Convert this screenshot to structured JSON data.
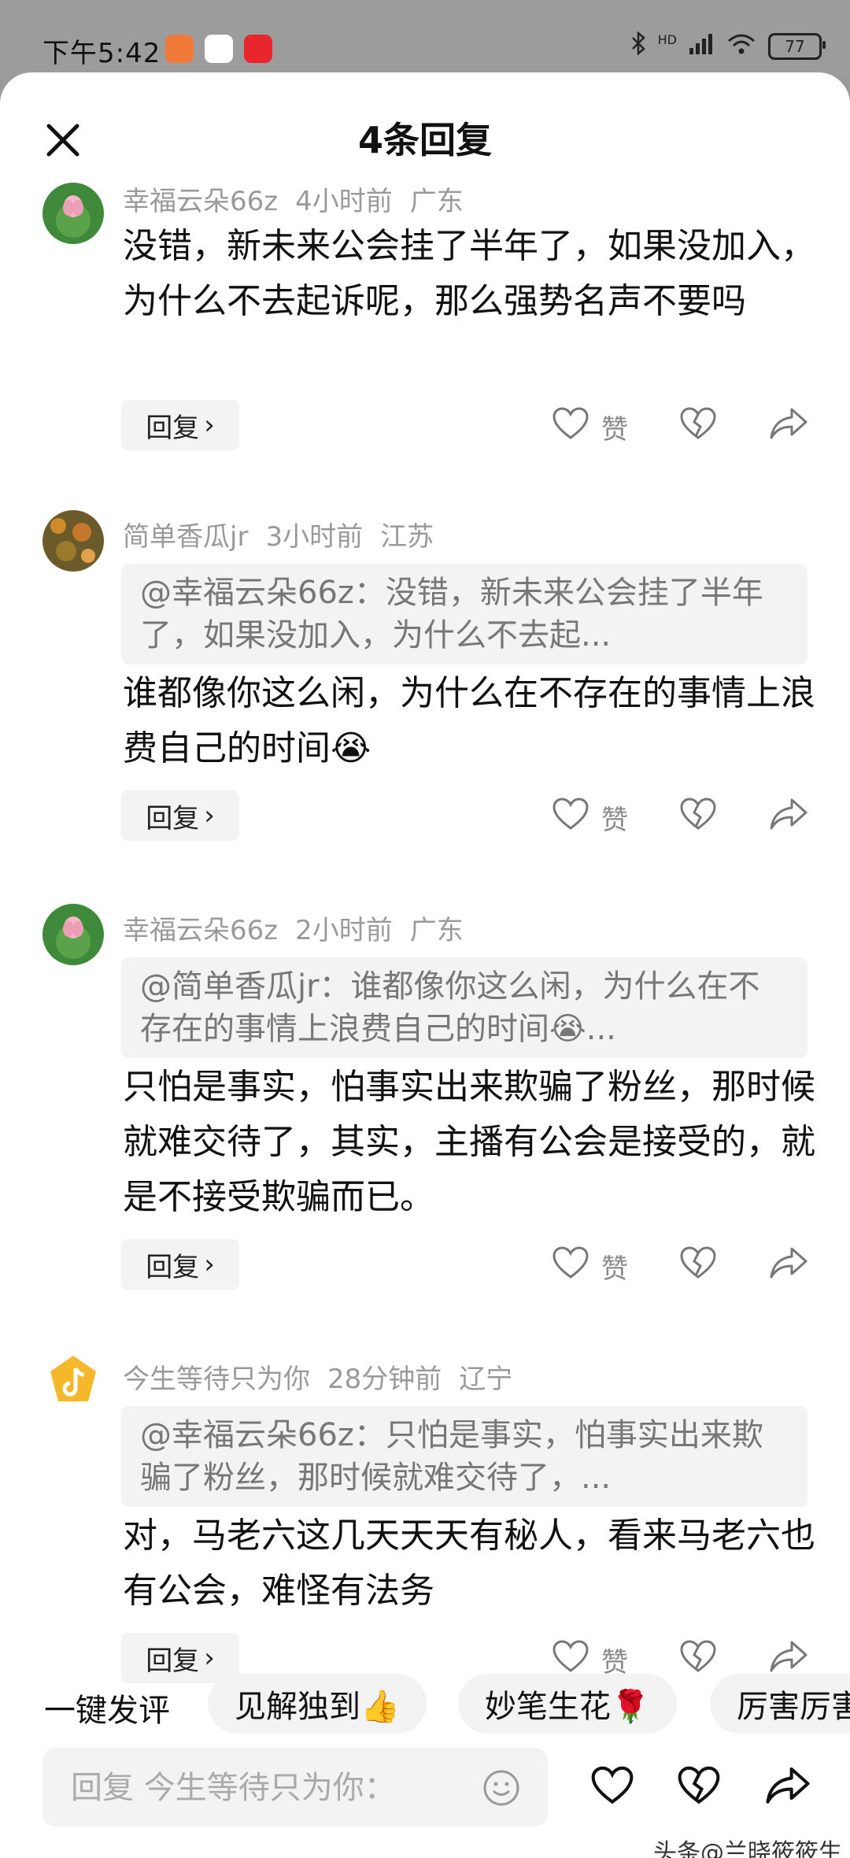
{
  "status_bar": {
    "time": "下午5:42",
    "network": "HD",
    "battery": "77"
  },
  "sheet": {
    "title": "4条回复"
  },
  "comments": [
    {
      "user": "幸福云朵66z",
      "time": "4小时前",
      "location": "广东",
      "text": "没错，新未来公会挂了半年了，如果没加入，为什么不去起诉呢，那么强势名声不要吗"
    },
    {
      "user": "简单香瓜jr",
      "time": "3小时前",
      "location": "江苏",
      "quote": "@幸福云朵66z：没错，新未来公会挂了半年了，如果没加入，为什么不去起...",
      "text": "谁都像你这么闲，为什么在不存在的事情上浪费自己的时间😭"
    },
    {
      "user": "幸福云朵66z",
      "time": "2小时前",
      "location": "广东",
      "quote": "@简单香瓜jr：谁都像你这么闲，为什么在不存在的事情上浪费自己的时间😭...",
      "text": "只怕是事实，怕事实出来欺骗了粉丝，那时候就难交待了，其实，主播有公会是接受的，就是不接受欺骗而已。"
    },
    {
      "user": "今生等待只为你",
      "time": "28分钟前",
      "location": "辽宁",
      "quote": "@幸福云朵66z：只怕是事实，怕事实出来欺骗了粉丝，那时候就难交待了，...",
      "text": "对，马老六这几天天天有秘人，看来马老六也有公会，难怪有法务"
    }
  ],
  "reply_label": "回复",
  "like_label": "赞",
  "quick_comment": {
    "label": "一键发评",
    "chips": [
      "见解独到👍",
      "妙笔生花🌹",
      "厉害厉害"
    ]
  },
  "input": {
    "placeholder": "回复 今生等待只为你："
  },
  "watermark": "头条@兰晓筱筱生"
}
